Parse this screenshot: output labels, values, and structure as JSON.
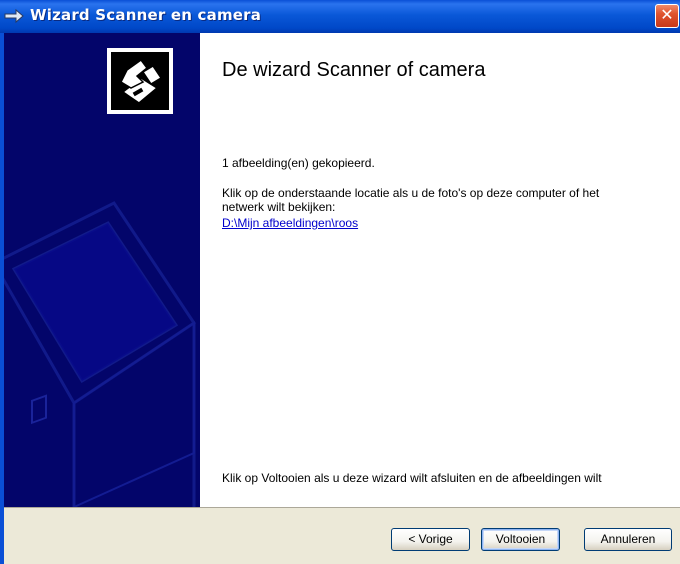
{
  "window": {
    "title": "Wizard Scanner en camera",
    "close_glyph": "✕"
  },
  "content": {
    "heading": "De wizard Scanner of camera",
    "copied_text": "1 afbeelding(en) gekopieerd.",
    "location_line1": "Klik op de onderstaande locatie als u de foto's op deze computer of het",
    "location_line2": "netwerk wilt bekijken:",
    "location_link": "D:\\Mijn afbeeldingen\\roos",
    "finish_text": "Klik op Voltooien als u deze wizard wilt afsluiten en de afbeeldingen wilt"
  },
  "buttons": {
    "back": "< Vorige",
    "finish": "Voltooien",
    "cancel": "Annuleren"
  },
  "icons": {
    "title_icon": "scanner-camera-arrow-icon",
    "wizard_icon": "scanner-camera-wizard-icon",
    "close_icon": "close-icon"
  },
  "colors": {
    "side_panel": "#03056a",
    "titlebar": "#0a4fd6",
    "link": "#0000cc",
    "bottom_bar": "#ece9d8"
  }
}
